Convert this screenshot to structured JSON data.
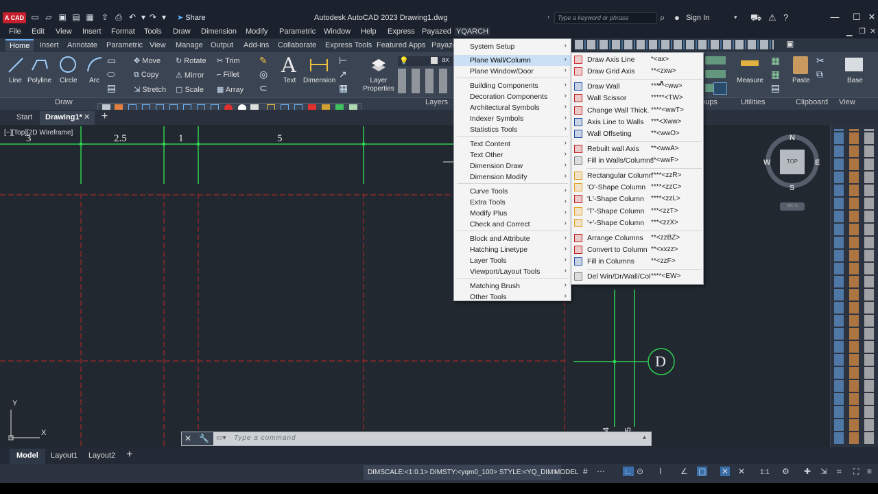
{
  "app": {
    "logo": "A CAD",
    "title": "Autodesk AutoCAD 2023   Drawing1.dwg",
    "share_label": "Share",
    "search_placeholder": "Type a keyword or phrase",
    "sign_in": "Sign In"
  },
  "menubar": [
    "File",
    "Edit",
    "View",
    "Insert",
    "Format",
    "Tools",
    "Draw",
    "Dimension",
    "Modify",
    "Parametric",
    "Window",
    "Help",
    "Express",
    "Payazed",
    "YQARCH"
  ],
  "ribbon_tabs": [
    "Home",
    "Insert",
    "Annotate",
    "Parametric",
    "View",
    "Manage",
    "Output",
    "Add-ins",
    "Collaborate",
    "Express Tools",
    "Featured Apps",
    "Payaze"
  ],
  "ribbon": {
    "draw_tools": [
      "Line",
      "Polyline",
      "Circle",
      "Arc"
    ],
    "modify_tools": [
      "Move",
      "Rotate",
      "Trim",
      "Copy",
      "Mirror",
      "Fillet",
      "Stretch",
      "Scale",
      "Array"
    ],
    "annotation": [
      "Text",
      "Dimension"
    ],
    "layer_properties": "Layer Properties",
    "layer_current": "ax",
    "right_tools": [
      "Measure",
      "Paste",
      "Base"
    ],
    "panels": {
      "draw": "Draw",
      "layers": "Layers",
      "groups": "oups",
      "utilities": "Utilities",
      "clipboard": "Clipboard",
      "view": "View"
    }
  },
  "file_tabs": {
    "start": "Start",
    "drawing": "Drawing1*"
  },
  "canvas": {
    "view_label": "[−][Top][2D Wireframe]",
    "dims": [
      "3",
      "2.5",
      "1",
      "5"
    ],
    "grid_bubble": "D",
    "ucs_x": "X",
    "ucs_y": "Y",
    "stray_labels": [
      "4",
      "5"
    ]
  },
  "viewcube": {
    "top": "TOP",
    "n": "N",
    "s": "S",
    "e": "E",
    "w": "W",
    "wcs": "WCS"
  },
  "command_line": {
    "placeholder": "Type a command"
  },
  "layout_tabs": [
    "Model",
    "Layout1",
    "Layout2"
  ],
  "status": {
    "text": "DIMSCALE:<1:0.1> DIMSTY:<yqm0_100> STYLE:<YQ_DIM>",
    "model": "MODEL",
    "scale": "1:1"
  },
  "yqarch_menu": [
    {
      "label": "System Setup",
      "group": 1
    },
    {
      "label": "Plane Wall/Column",
      "group": 1,
      "highlighted": true
    },
    {
      "label": "Plane Window/Door",
      "group": 1
    },
    {
      "label": "Building Components",
      "group": 2
    },
    {
      "label": "Decoration Components",
      "group": 2
    },
    {
      "label": "Architectural Symbols",
      "group": 2
    },
    {
      "label": "Indexer Symbols",
      "group": 2
    },
    {
      "label": "Statistics Tools",
      "group": 2
    },
    {
      "label": "Text Content",
      "group": 3
    },
    {
      "label": "Text Other",
      "group": 3
    },
    {
      "label": "Dimension Draw",
      "group": 3
    },
    {
      "label": "Dimension Modify",
      "group": 3
    },
    {
      "label": "Curve Tools",
      "group": 4
    },
    {
      "label": "Extra Tools",
      "group": 4
    },
    {
      "label": "Modify Plus",
      "group": 4
    },
    {
      "label": "Check and Correct",
      "group": 4
    },
    {
      "label": "Block and Attribute",
      "group": 5
    },
    {
      "label": "Hatching  Linetype",
      "group": 5
    },
    {
      "label": "Layer Tools",
      "group": 5
    },
    {
      "label": "Viewport/Layout Tools",
      "group": 5
    },
    {
      "label": "Matching Brush",
      "group": 6
    },
    {
      "label": "Other Tools",
      "group": 6
    }
  ],
  "submenu": [
    {
      "label": "Draw Axis Line",
      "shortcut": "*<ax>",
      "icon_color": "#d03030"
    },
    {
      "label": "Draw Grid Axis",
      "shortcut": "**<zxw>",
      "icon_color": "#d03030"
    },
    {
      "label": "Draw Wall",
      "shortcut": "*****<ww>",
      "icon_color": "#2050a0",
      "group_start": true
    },
    {
      "label": "Wall Scissor",
      "shortcut": "*****<TW>",
      "icon_color": "#c02020"
    },
    {
      "label": "Change Wall Thick.",
      "shortcut": "****<wwT>",
      "icon_color": "#c02020"
    },
    {
      "label": "Axis Line to Walls",
      "shortcut": "***<Xww>",
      "icon_color": "#2050a0"
    },
    {
      "label": "Wall Offseting",
      "shortcut": "**<wwO>",
      "icon_color": "#2050a0"
    },
    {
      "label": "Rebuilt wall Axis",
      "shortcut": "**<wwA>",
      "icon_color": "#c02020",
      "group_start": true
    },
    {
      "label": "Fill in Walls/Columns",
      "shortcut": "**<wwF>",
      "icon_color": "#808080"
    },
    {
      "label": "Rectangular Column",
      "shortcut": "****<zzR>",
      "icon_color": "#e0a020",
      "group_start": true
    },
    {
      "label": "'O'-Shape Column",
      "shortcut": "****<zzC>",
      "icon_color": "#e0a020"
    },
    {
      "label": "'L'-Shape Column",
      "shortcut": "****<zzL>",
      "icon_color": "#c02020"
    },
    {
      "label": "'T'-Shape Column",
      "shortcut": "***<zzT>",
      "icon_color": "#e0a020"
    },
    {
      "label": "'+'-Shape Column",
      "shortcut": "***<zzX>",
      "icon_color": "#e0a020"
    },
    {
      "label": "Arrange Columns",
      "shortcut": "**<zzBZ>",
      "icon_color": "#c02020",
      "group_start": true
    },
    {
      "label": "Convert to Column",
      "shortcut": "**<xxzz>",
      "icon_color": "#c02020"
    },
    {
      "label": "Fill in Columns",
      "shortcut": "**<zzF>",
      "icon_color": "#2050a0"
    },
    {
      "label": "Del Win/Dr/Wall/Col",
      "shortcut": "****<EW>",
      "icon_color": "#808080",
      "group_start": true
    }
  ]
}
